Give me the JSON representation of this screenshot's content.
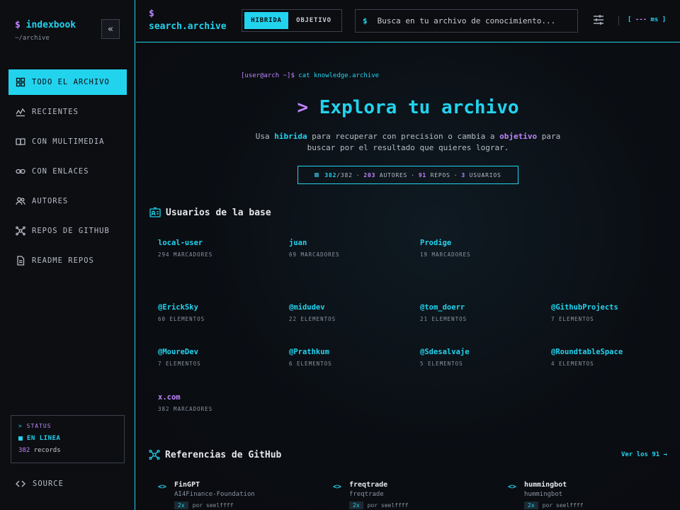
{
  "colors": {
    "accent": "#22d3ee",
    "secondary": "#c084fc",
    "bg": "#0a0c10"
  },
  "sidebar": {
    "brand_symbol": "$",
    "brand_name": "indexbook",
    "brand_path": "~/archive",
    "collapse_glyph": "«",
    "items": [
      {
        "label": "TODO EL ARCHIVO",
        "icon": "grid-icon",
        "active": true
      },
      {
        "label": "RECIENTES",
        "icon": "activity-icon"
      },
      {
        "label": "CON MULTIMEDIA",
        "icon": "book-open-icon"
      },
      {
        "label": "CON ENLACES",
        "icon": "link-icon"
      },
      {
        "label": "AUTORES",
        "icon": "users-icon"
      },
      {
        "label": "REPOS DE GITHUB",
        "icon": "network-icon"
      },
      {
        "label": "README REPOS",
        "icon": "file-icon"
      }
    ],
    "status": {
      "header_prefix": ">",
      "header": "STATUS",
      "state": "EN LINEA",
      "records_count": "382",
      "records_label": "records"
    },
    "source_label": "SOURCE"
  },
  "topbar": {
    "search_symbol": "$",
    "search_label": "search.archive",
    "modes": [
      "HIBRIDA",
      "OBJETIVO"
    ],
    "search_prompt": "$",
    "search_placeholder": "Busca en tu archivo de conocimiento...",
    "latency_open": "[",
    "latency_value": "---",
    "latency_unit": "ms ]"
  },
  "hero": {
    "prompt_user": "[user@arch ~]$",
    "prompt_cmd": "cat knowledge.archive",
    "title_prefix": ">",
    "title": "Explora tu archivo",
    "desc_1": "Usa ",
    "desc_hl_1": "hibrida",
    "desc_2": " para recuperar con precision o cambia a ",
    "desc_hl_2": "objetivo",
    "desc_3": " para buscar por el resultado que quieres lograr.",
    "stats": {
      "shown": "382",
      "total": "/382",
      "authors": "203",
      "authors_label": "AUTORES",
      "repos": "91",
      "repos_label": "REPOS",
      "users": "3",
      "users_label": "USUARIOS",
      "separator": "·"
    }
  },
  "users_section": {
    "title": "Usuarios de la base",
    "rows": [
      [
        {
          "name": "local-user",
          "count": "294 MARCADORES"
        },
        {
          "name": "juan",
          "count": "69 MARCADORES"
        },
        {
          "name": "Prodige",
          "count": "19 MARCADORES"
        }
      ],
      [
        {
          "name": "@ErickSky",
          "count": "60 ELEMENTOS"
        },
        {
          "name": "@midudev",
          "count": "22 ELEMENTOS"
        },
        {
          "name": "@tom_doerr",
          "count": "21 ELEMENTOS"
        },
        {
          "name": "@GithubProjects",
          "count": "7 ELEMENTOS"
        }
      ],
      [
        {
          "name": "@MoureDev",
          "count": "7 ELEMENTOS"
        },
        {
          "name": "@Prathkum",
          "count": "6 ELEMENTOS"
        },
        {
          "name": "@Sdesalvaje",
          "count": "5 ELEMENTOS"
        },
        {
          "name": "@RoundtableSpace",
          "count": "4 ELEMENTOS"
        }
      ],
      [
        {
          "name": "x.com",
          "count": "382 MARCADORES"
        }
      ]
    ]
  },
  "github_section": {
    "title": "Referencias de GitHub",
    "see_all": "Ver los 91 →",
    "repos": [
      {
        "name": "FinGPT",
        "owner": "AI4Finance-Foundation",
        "badge": "2x",
        "by": "por seelffff"
      },
      {
        "name": "freqtrade",
        "owner": "freqtrade",
        "badge": "2x",
        "by": "por seelffff"
      },
      {
        "name": "hummingbot",
        "owner": "hummingbot",
        "badge": "2x",
        "by": "por seelffff"
      }
    ]
  }
}
